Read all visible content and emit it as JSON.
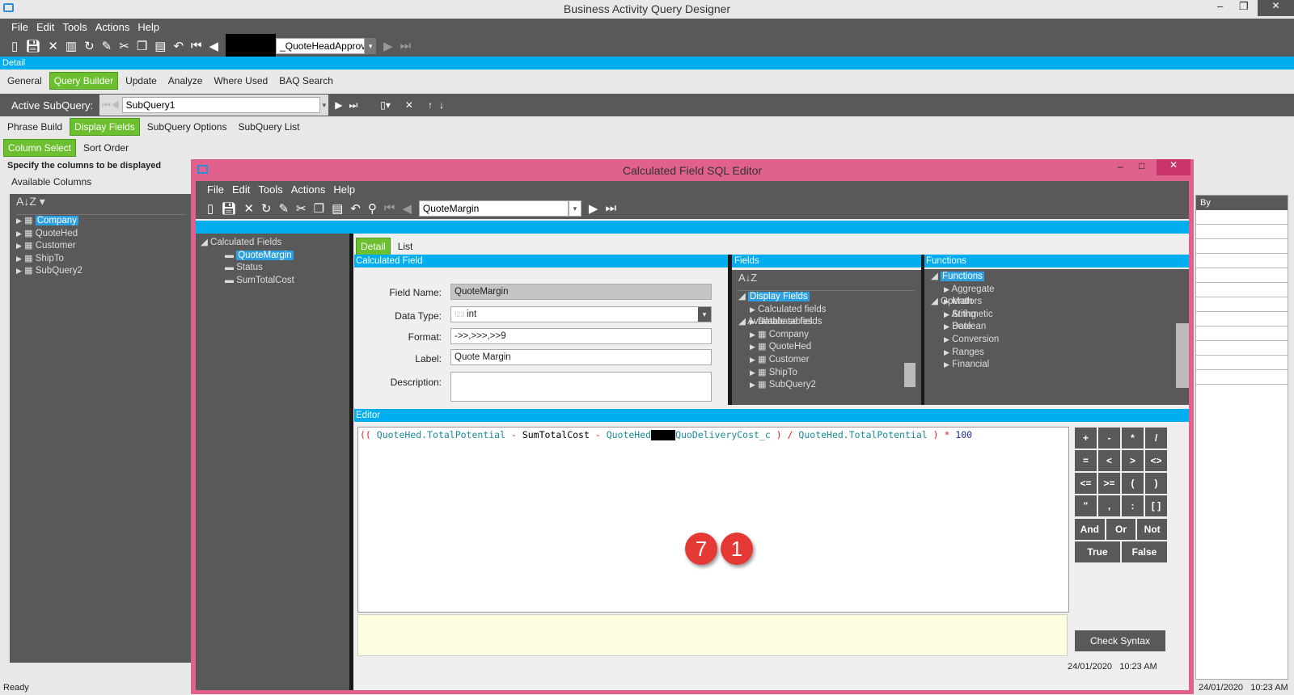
{
  "app": {
    "title": "Business Activity Query Designer",
    "menu": [
      "File",
      "Edit",
      "Tools",
      "Actions",
      "Help"
    ],
    "query_id": "_QuoteHeadApprov",
    "detail_label": "Detail",
    "tabs": [
      {
        "label": "General"
      },
      {
        "label": "Query Builder",
        "active": true
      },
      {
        "label": "Update"
      },
      {
        "label": "Analyze"
      },
      {
        "label": "Where Used"
      },
      {
        "label": "BAQ Search"
      }
    ],
    "active_subquery_label": "Active SubQuery:",
    "active_subquery": "SubQuery1",
    "subtabs": [
      {
        "label": "Phrase Build"
      },
      {
        "label": "Display Fields",
        "active": true
      },
      {
        "label": "SubQuery Options"
      },
      {
        "label": "SubQuery List"
      }
    ],
    "coltabs": [
      {
        "label": "Column Select",
        "active": true
      },
      {
        "label": "Sort Order"
      }
    ],
    "instructions": "Specify the columns to be displayed",
    "available_columns": "Available Columns",
    "tables": [
      "Company",
      "QuoteHed",
      "Customer",
      "ShipTo",
      "SubQuery2"
    ],
    "grid_header": "By",
    "status": "Ready",
    "date": "24/01/2020",
    "time": "10:23 AM"
  },
  "dialog": {
    "title": "Calculated Field SQL Editor",
    "menu": [
      "File",
      "Edit",
      "Tools",
      "Actions",
      "Help"
    ],
    "field_select": "QuoteMargin",
    "tree_root": "Calculated Fields",
    "tree_items": [
      "QuoteMargin",
      "Status",
      "SumTotalCost"
    ],
    "tabs": [
      {
        "label": "Detail",
        "active": true
      },
      {
        "label": "List"
      }
    ],
    "calc_header": "Calculated Field",
    "form": {
      "field_name_label": "Field Name:",
      "field_name": "QuoteMargin",
      "data_type_label": "Data Type:",
      "data_type": "int",
      "format_label": "Format:",
      "format": "->>,>>>,>>9",
      "label_label": "Label:",
      "label": "Quote Margin",
      "description_label": "Description:",
      "description": ""
    },
    "fields_header": "Fields",
    "fields_tree": {
      "display": "Display Fields",
      "display_children": [
        "Calculated fields",
        "Database fields"
      ],
      "available": "Available tables",
      "tables": [
        "Company",
        "QuoteHed",
        "Customer",
        "ShipTo",
        "SubQuery2"
      ]
    },
    "functions_header": "Functions",
    "functions_tree": {
      "root": "Functions",
      "children": [
        "Aggregate",
        "Math",
        "String",
        "Date",
        "Conversion",
        "Ranges",
        "Financial"
      ],
      "operators": "Operators",
      "op_children": [
        "Arithmetic",
        "Boolean"
      ]
    },
    "editor_header": "Editor",
    "expression": [
      {
        "t": "((",
        "c": "op"
      },
      {
        "t": " QuoteHed.TotalPotential ",
        "c": "fld"
      },
      {
        "t": "-",
        "c": "op"
      },
      {
        "t": " SumTotalCost ",
        "c": "plain"
      },
      {
        "t": "-",
        "c": "op"
      },
      {
        "t": " QuoteHed",
        "c": "fld"
      },
      {
        "t": "REDACT",
        "c": "redact"
      },
      {
        "t": "QuoDeliveryCost_c ",
        "c": "fld"
      },
      {
        "t": ")",
        "c": "op"
      },
      {
        "t": " / ",
        "c": "op"
      },
      {
        "t": "QuoteHed.TotalPotential ",
        "c": "fld"
      },
      {
        "t": ")",
        "c": "op"
      },
      {
        "t": " * ",
        "c": "op"
      },
      {
        "t": "100",
        "c": "num"
      }
    ],
    "keys": [
      "+",
      "-",
      "*",
      "/",
      "=",
      "<",
      ">",
      "<>",
      "<=",
      ">=",
      "(",
      ")",
      "\"",
      ",",
      ":",
      "[ ]"
    ],
    "logic_keys": [
      "And",
      "Or",
      "Not"
    ],
    "bool_keys": [
      "True",
      "False"
    ],
    "check_syntax": "Check Syntax",
    "date": "24/01/2020",
    "time": "10:23 AM"
  },
  "annotations": [
    "7",
    "1"
  ],
  "colors": {
    "accent": "#00adef",
    "dialog_border": "#e0608e",
    "active_tab": "#6cbf2e",
    "panel": "#595959"
  }
}
